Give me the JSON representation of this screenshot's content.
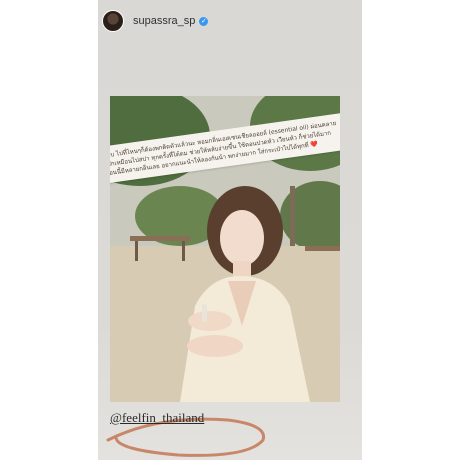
{
  "story": {
    "username": "supassra_sp",
    "verified_icon": "verified-badge-icon",
    "caption": "ชอบ ไปที่ไหนๆก็ต้องพกติดตัวแล้วนะ หอมกลิ่นเอสเซนเชียลออยล์ (essential oil) ผ่อนคลาย รู้สึกเหมือนไปสปา ทุกครั้งที่ได้ดม ช่วยให้หลับง่ายขึ้น ใช้ตอนปวดหัว เวียนหัว ก็ช่วยได้มาก ตอนนี้มีหลายกลิ่นเลย อยากแนะนำให้ลองกันน้า พกง่ายมาก ใส่กระเป๋าไปได้ทุกที่ ❤️",
    "mention": "@feelfin_thailand",
    "colors": {
      "story_bg": "#dcdad6",
      "caption_bg": "#f6f3ee",
      "swoosh": "#c9876a"
    }
  }
}
